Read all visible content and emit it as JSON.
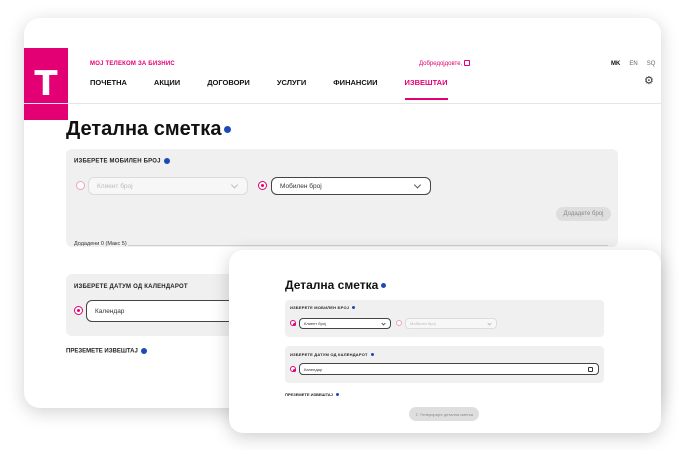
{
  "header": {
    "logo_glyph": "T",
    "brand_subtitle": "МОЈ ТЕЛЕКОМ ЗА БИЗНИС",
    "welcome": "Добредојдовте,",
    "languages": [
      "MK",
      "EN",
      "SQ"
    ],
    "active_language": "MK"
  },
  "nav": {
    "items": [
      "ПОЧЕТНА",
      "АКЦИИ",
      "ДОГОВОРИ",
      "УСЛУГИ",
      "ФИНАНСИИ",
      "ИЗВЕШТАИ"
    ],
    "active": "ИЗВЕШТАИ"
  },
  "back": {
    "title": "Детална сметка",
    "mobile_section_label": "ИЗБЕРЕТЕ МОБИЛЕН БРОЈ",
    "client_number_placeholder": "Клиент број",
    "mobile_number_value": "Мобилен број",
    "add_number_button": "Додадете број",
    "added_label": "Додадени 0 (Макс 5)",
    "date_section_label": "ИЗБЕРЕТЕ ДАТУМ ОД КАЛЕНДАРОТ",
    "calendar_value": "Календар",
    "download_label": "ПРЕЗЕМЕТЕ ИЗВЕШТАЈ"
  },
  "front": {
    "title": "Детална сметка",
    "mobile_section_label": "ИЗБЕРЕТЕ МОБИЛЕН БРОЈ",
    "client_number_value": "Клиент број",
    "mobile_number_placeholder": "Мобилен број",
    "date_section_label": "ИЗБЕРЕТЕ ДАТУМ ОД КАЛЕНДАРОТ",
    "calendar_value": "Календар",
    "download_label": "ПРЕЗЕМЕТЕ ИЗВЕШТАЈ",
    "generate_button": "Генерирајте детална сметка"
  },
  "colors": {
    "brand": "#e20074",
    "info": "#1c4ab8",
    "panel": "#f0f0f0"
  }
}
